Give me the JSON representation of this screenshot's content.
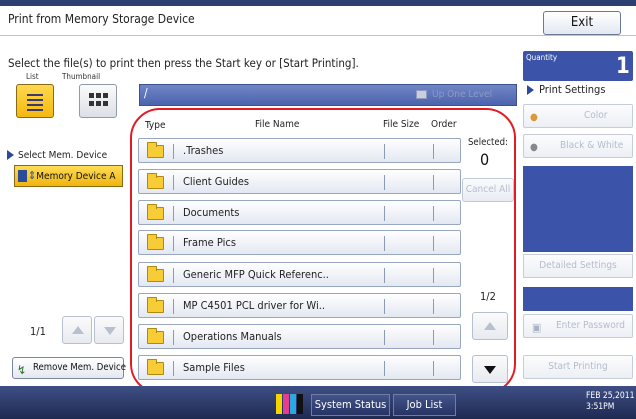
{
  "window": {
    "title": "Print from Memory Storage Device",
    "exit_label": "Exit"
  },
  "instruction": "Select the file(s) to print then press the Start key or [Start Printing].",
  "view_mode": {
    "list_label": "List",
    "thumbnail_label": "Thumbnail",
    "selected": "List"
  },
  "device_panel": {
    "select_label": "Select Mem. Device",
    "device_name": "Memory Device A",
    "page_indicator": "1/1",
    "remove_label": "Remove Mem. Device"
  },
  "file_browser": {
    "path": "/",
    "up_label": "Up One Level",
    "columns": {
      "type": "Type",
      "file_name": "File Name",
      "file_size": "File Size",
      "order": "Order"
    },
    "files": [
      {
        "name": ".Trashes"
      },
      {
        "name": "Client Guides"
      },
      {
        "name": "Documents"
      },
      {
        "name": "Frame Pics"
      },
      {
        "name": "Generic MFP Quick Referenc.."
      },
      {
        "name": "MP C4501 PCL driver for Wi.."
      },
      {
        "name": "Operations Manuals"
      },
      {
        "name": "Sample Files"
      }
    ],
    "selected_label": "Selected:",
    "selected_count": "0",
    "cancel_all_label": "Cancel All",
    "page_indicator": "1/2"
  },
  "right_panel": {
    "quantity_label": "Quantity",
    "quantity_value": "1",
    "print_settings_label": "Print Settings",
    "color_label": "Color",
    "bw_label": "Black & White",
    "detailed_label": "Detailed Settings",
    "password_label": "Enter Password",
    "start_label": "Start Printing"
  },
  "status_bar": {
    "system_status_label": "System Status",
    "job_list_label": "Job List",
    "date": "FEB  25,2011",
    "time": "3:51PM"
  },
  "colors": {
    "accent_blue": "#3b53a8",
    "active_yellow": "#f4b90f",
    "highlight_red": "#e21c24"
  }
}
